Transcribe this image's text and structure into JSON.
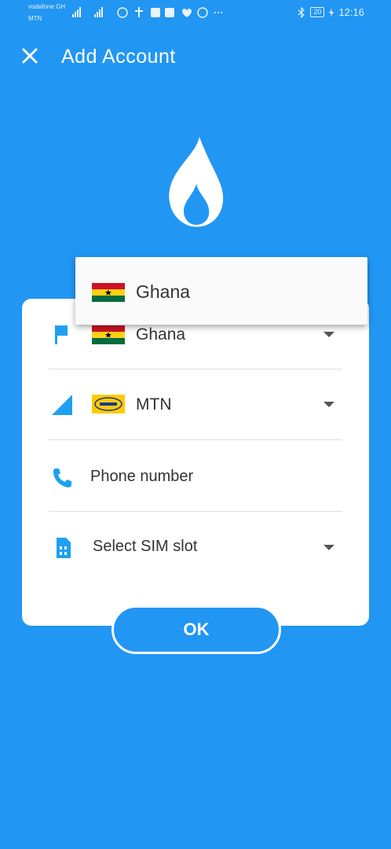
{
  "status_bar": {
    "carrier1": "vodafone GH",
    "carrier2": "MTN",
    "battery": "20",
    "time": "12:16"
  },
  "header": {
    "title": "Add Account"
  },
  "form": {
    "country": "Ghana",
    "network": "MTN",
    "phone_placeholder": "Phone number",
    "sim_slot": "Select SIM slot"
  },
  "dropdown": {
    "items": [
      "Ghana"
    ]
  },
  "ok_button": "OK",
  "colors": {
    "primary": "#2196f3",
    "icon_blue": "#1ea0f0"
  }
}
